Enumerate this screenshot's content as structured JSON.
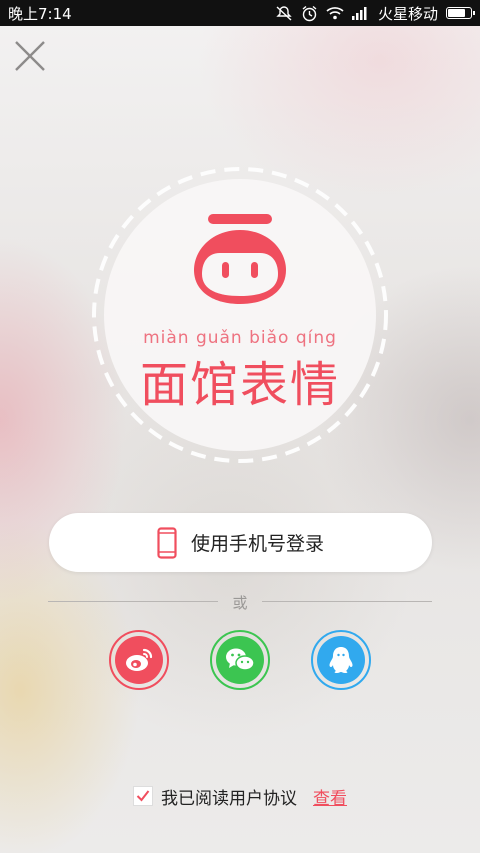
{
  "status_bar": {
    "time": "晚上7:14",
    "carrier": "火星移动",
    "icons": [
      "mute-icon",
      "alarm-icon",
      "wifi-icon",
      "signal-icon",
      "battery-icon"
    ],
    "battery_level": 0.85
  },
  "header": {
    "close_icon": "close-icon"
  },
  "logo": {
    "pinyin": "miàn guǎn biǎo qíng",
    "name": "面馆表情",
    "mascot_icon": "pig-face-icon"
  },
  "login": {
    "phone_label": "使用手机号登录",
    "phone_icon": "phone-icon",
    "or_text": "或",
    "social": [
      {
        "name": "weibo",
        "icon": "weibo-icon",
        "color": "#f04e5e"
      },
      {
        "name": "wechat",
        "icon": "wechat-icon",
        "color": "#3cc551"
      },
      {
        "name": "qq",
        "icon": "qq-icon",
        "color": "#31a9ee"
      }
    ]
  },
  "agreement": {
    "checked": true,
    "text": "我已阅读用户协议",
    "link_label": "查看"
  },
  "colors": {
    "accent": "#f04e5e",
    "wechat": "#3cc551",
    "qq": "#31a9ee"
  }
}
